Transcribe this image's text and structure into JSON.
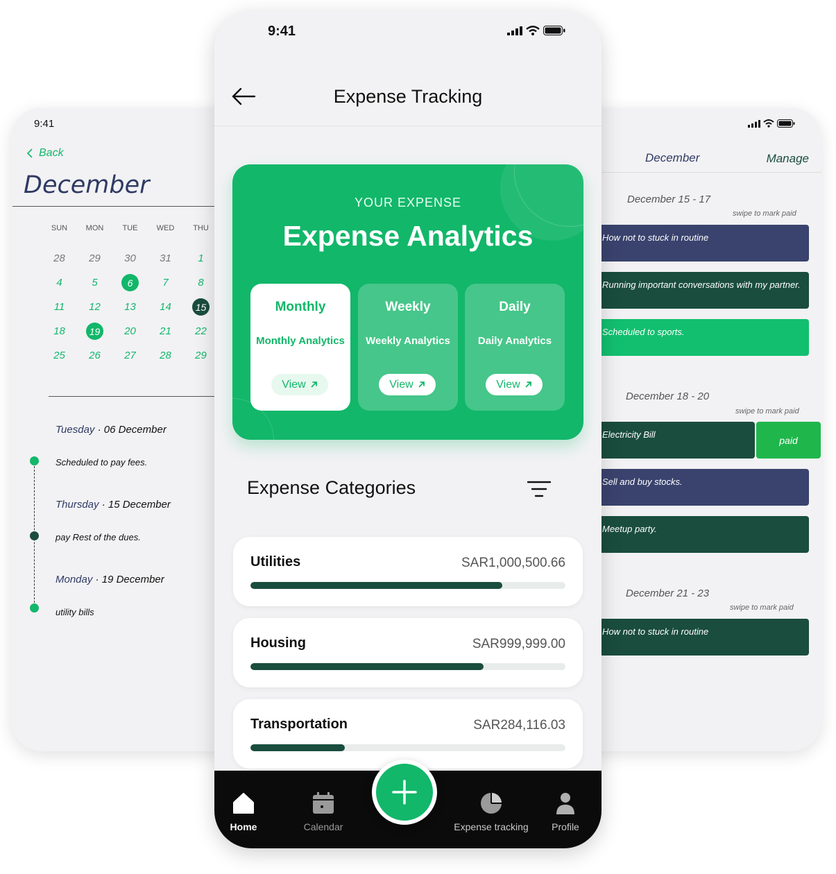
{
  "left_phone": {
    "status_time": "9:41",
    "back_label": "Back",
    "month_title": "December",
    "weekdays": [
      "SUN",
      "MON",
      "TUE",
      "WED",
      "THU"
    ],
    "weeks": [
      [
        "28",
        "29",
        "30",
        "31",
        "1"
      ],
      [
        "4",
        "5",
        "6",
        "7",
        "8"
      ],
      [
        "11",
        "12",
        "13",
        "14",
        "15"
      ],
      [
        "18",
        "19",
        "20",
        "21",
        "22"
      ],
      [
        "25",
        "26",
        "27",
        "28",
        "29"
      ]
    ],
    "timeline": [
      {
        "weekday": "Tuesday",
        "date": "06 December",
        "event": "Scheduled to pay fees."
      },
      {
        "weekday": "Thursday",
        "date": "15 December",
        "event": "pay Rest of the dues."
      },
      {
        "weekday": "Monday",
        "date": "19 December",
        "event": "utility bills"
      }
    ],
    "separator": " · "
  },
  "right_phone": {
    "month": "December",
    "manage_label": "Manage",
    "swipe_hint": "swipe to mark paid",
    "paid_label": "paid",
    "groups": [
      {
        "range": "December 15 - 17",
        "items": [
          "How not to stuck in routine",
          "Running important conversations with my partner.",
          "Scheduled to sports."
        ]
      },
      {
        "range": "December 18 - 20",
        "items": [
          "Electricity Bill",
          "Sell and buy stocks.",
          "Meetup party."
        ]
      },
      {
        "range": "December 21 - 23",
        "items": [
          "How not to stuck in routine"
        ]
      }
    ]
  },
  "center_phone": {
    "status_time": "9:41",
    "title": "Expense Tracking",
    "hero": {
      "kicker": "YOUR EXPENSE",
      "title": "Expense Analytics",
      "tiles": [
        {
          "title": "Monthly",
          "subtitle": "Monthly Analytics",
          "button": "View"
        },
        {
          "title": "Weekly",
          "subtitle": "Weekly Analytics",
          "button": "View"
        },
        {
          "title": "Daily",
          "subtitle": "Daily Analytics",
          "button": "View"
        }
      ]
    },
    "categories_title": "Expense Categories",
    "categories": [
      {
        "name": "Utilities",
        "amount": "SAR1,000,500.66",
        "progress": 0.8
      },
      {
        "name": "Housing",
        "amount": "SAR999,999.00",
        "progress": 0.74
      },
      {
        "name": "Transportation",
        "amount": "SAR284,116.03",
        "progress": 0.3
      }
    ],
    "tabs": [
      {
        "label": "Home",
        "icon": "home-icon"
      },
      {
        "label": "Calendar",
        "icon": "calendar-icon"
      },
      {
        "label": "Expense tracking",
        "icon": "pie-chart-icon"
      },
      {
        "label": "Profile",
        "icon": "user-icon"
      }
    ]
  },
  "colors": {
    "brand_green": "#12b76a",
    "dark_green": "#1a4d3e",
    "navy": "#3a436e",
    "tab_bar": "#0b0b0b"
  }
}
